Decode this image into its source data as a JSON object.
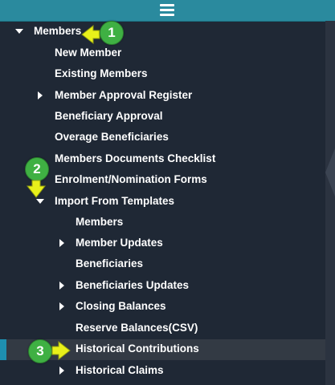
{
  "header": {
    "menu_icon": "hamburger-icon",
    "color": "#2a8a9e"
  },
  "menu": {
    "members": {
      "label": "Members",
      "state": "expanded"
    },
    "new_member": {
      "label": "New Member"
    },
    "existing_members": {
      "label": "Existing Members"
    },
    "member_approval_register": {
      "label": "Member Approval Register",
      "state": "collapsed"
    },
    "beneficiary_approval": {
      "label": "Beneficiary Approval"
    },
    "overage_beneficiaries": {
      "label": "Overage Beneficiaries"
    },
    "members_documents_checklist": {
      "label": "Members Documents Checklist"
    },
    "enrolment_nomination_forms": {
      "label": "Enrolment/Nomination Forms"
    },
    "import_from_templates": {
      "label": "Import From Templates",
      "state": "expanded"
    },
    "import_members": {
      "label": "Members"
    },
    "member_updates": {
      "label": "Member Updates",
      "state": "collapsed"
    },
    "beneficiaries": {
      "label": "Beneficiaries"
    },
    "beneficiaries_updates": {
      "label": "Beneficiaries Updates",
      "state": "collapsed"
    },
    "closing_balances": {
      "label": "Closing Balances",
      "state": "collapsed"
    },
    "reserve_balances_csv": {
      "label": "Reserve Balances(CSV)"
    },
    "historical_contributions": {
      "label": "Historical Contributions",
      "state": "active"
    },
    "historical_claims": {
      "label": "Historical Claims",
      "state": "collapsed"
    }
  },
  "annotations": {
    "step1": "1",
    "step2": "2",
    "step3": "3",
    "badge_color": "#3fb043",
    "arrow_color": "#e8f01a"
  },
  "colors": {
    "background": "#1f2835",
    "active_row": "#333a44",
    "active_marker": "#1e8fb0",
    "text": "#ffffff"
  }
}
